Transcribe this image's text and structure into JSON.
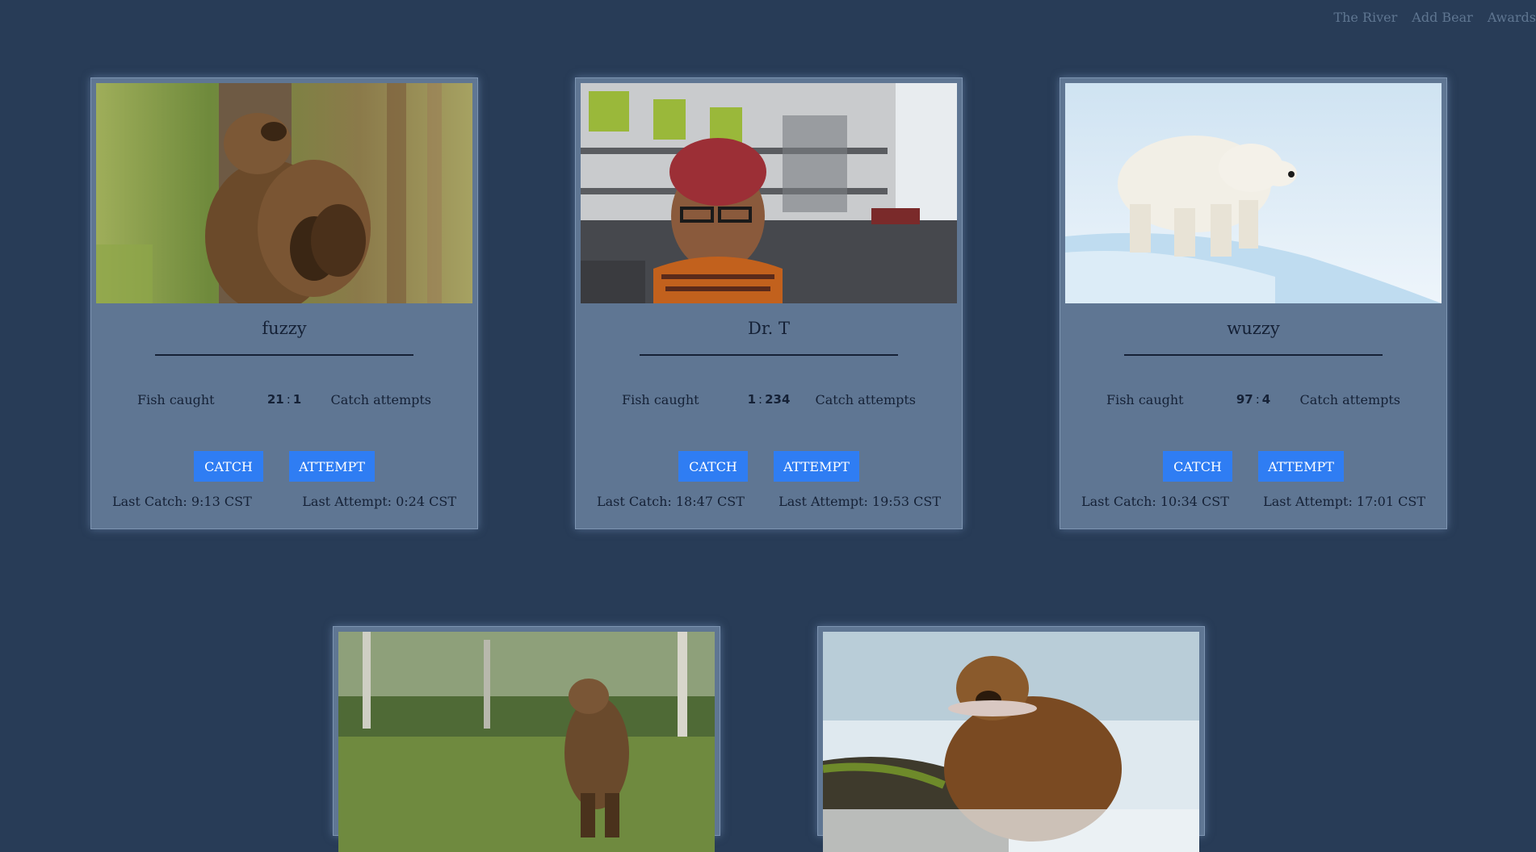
{
  "nav": {
    "items": [
      "The River",
      "Add Bear",
      "Awards"
    ]
  },
  "buttons": {
    "catch": "CATCH",
    "attempt": "ATTEMPT"
  },
  "labels": {
    "fish_caught": "Fish caught",
    "catch_attempts": "Catch attempts",
    "separator": ":"
  },
  "bears": [
    {
      "name": "fuzzy",
      "fish": "21",
      "attempts": "1",
      "last_catch": "Last Catch: 9:13 CST",
      "last_attempt": "Last Attempt: 0:24 CST",
      "photo": "brown-bear-tree-photo"
    },
    {
      "name": "Dr. T",
      "fish": "1",
      "attempts": "234",
      "last_catch": "Last Catch: 18:47 CST",
      "last_attempt": "Last Attempt: 19:53 CST",
      "photo": "person-selfie-photo"
    },
    {
      "name": "wuzzy",
      "fish": "97",
      "attempts": "4",
      "last_catch": "Last Catch: 10:34 CST",
      "last_attempt": "Last Attempt: 17:01 CST",
      "photo": "polar-bear-photo"
    },
    {
      "photo": "standing-bear-meadow-photo"
    },
    {
      "photo": "bear-salmon-river-photo"
    }
  ]
}
